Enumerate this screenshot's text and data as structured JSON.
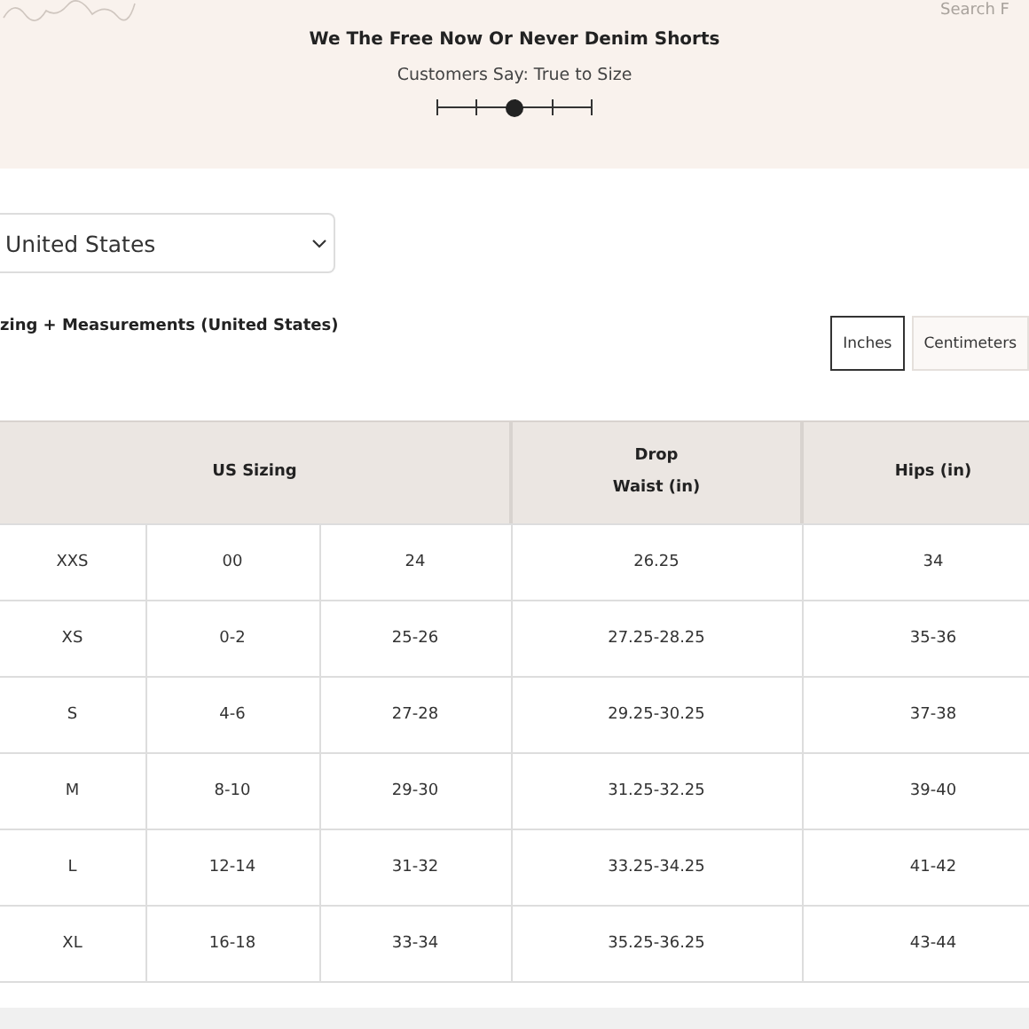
{
  "header": {
    "search_placeholder": "Search F",
    "product_title": "We The Free Now Or Never Denim Shorts",
    "fit_label": "Customers Say: True to Size",
    "fit_slider": {
      "level": 0.5
    }
  },
  "country_select": {
    "value": "United States"
  },
  "section_title": "zing + Measurements (United States)",
  "unit_toggle": [
    {
      "label": "Inches",
      "selected": true
    },
    {
      "label": "Centimeters",
      "selected": false
    }
  ],
  "table": {
    "header_groups": [
      {
        "label": "US Sizing"
      },
      {
        "label": "Drop\nWaist (in)"
      },
      {
        "label": "Hips (in)"
      }
    ],
    "rows": [
      [
        "XXS",
        "00",
        "24",
        "26.25",
        "34"
      ],
      [
        "XS",
        "0-2",
        "25-26",
        "27.25-28.25",
        "35-36"
      ],
      [
        "S",
        "4-6",
        "27-28",
        "29.25-30.25",
        "37-38"
      ],
      [
        "M",
        "8-10",
        "29-30",
        "31.25-32.25",
        "39-40"
      ],
      [
        "L",
        "12-14",
        "31-32",
        "33.25-34.25",
        "41-42"
      ],
      [
        "XL",
        "16-18",
        "33-34",
        "35.25-36.25",
        "43-44"
      ]
    ]
  }
}
